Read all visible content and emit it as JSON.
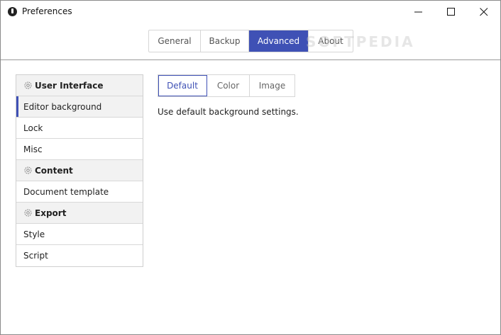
{
  "window": {
    "title": "Preferences",
    "icon": "app-logo-icon"
  },
  "title_controls": {
    "minimize": "minimize-icon",
    "maximize": "maximize-icon",
    "close": "close-icon"
  },
  "top_tabs": [
    {
      "label": "General",
      "selected": false
    },
    {
      "label": "Backup",
      "selected": false
    },
    {
      "label": "Advanced",
      "selected": true
    },
    {
      "label": "About",
      "selected": false
    }
  ],
  "watermark": "SOFTPEDIA",
  "sidebar": {
    "sections": [
      {
        "label": "User Interface",
        "icon": "gear-icon",
        "items": [
          "Editor background",
          "Lock",
          "Misc"
        ]
      },
      {
        "label": "Content",
        "icon": "gear-icon",
        "items": [
          "Document template"
        ]
      },
      {
        "label": "Export",
        "icon": "gear-icon",
        "items": [
          "Style",
          "Script"
        ]
      }
    ],
    "selected_item": "Editor background"
  },
  "sub_tabs": [
    {
      "label": "Default",
      "selected": true
    },
    {
      "label": "Color",
      "selected": false
    },
    {
      "label": "Image",
      "selected": false
    }
  ],
  "content": {
    "description": "Use default background settings."
  },
  "colors": {
    "accent": "#3f51b5",
    "header_bg": "#f2f2f2",
    "border": "#d6d6d6"
  }
}
